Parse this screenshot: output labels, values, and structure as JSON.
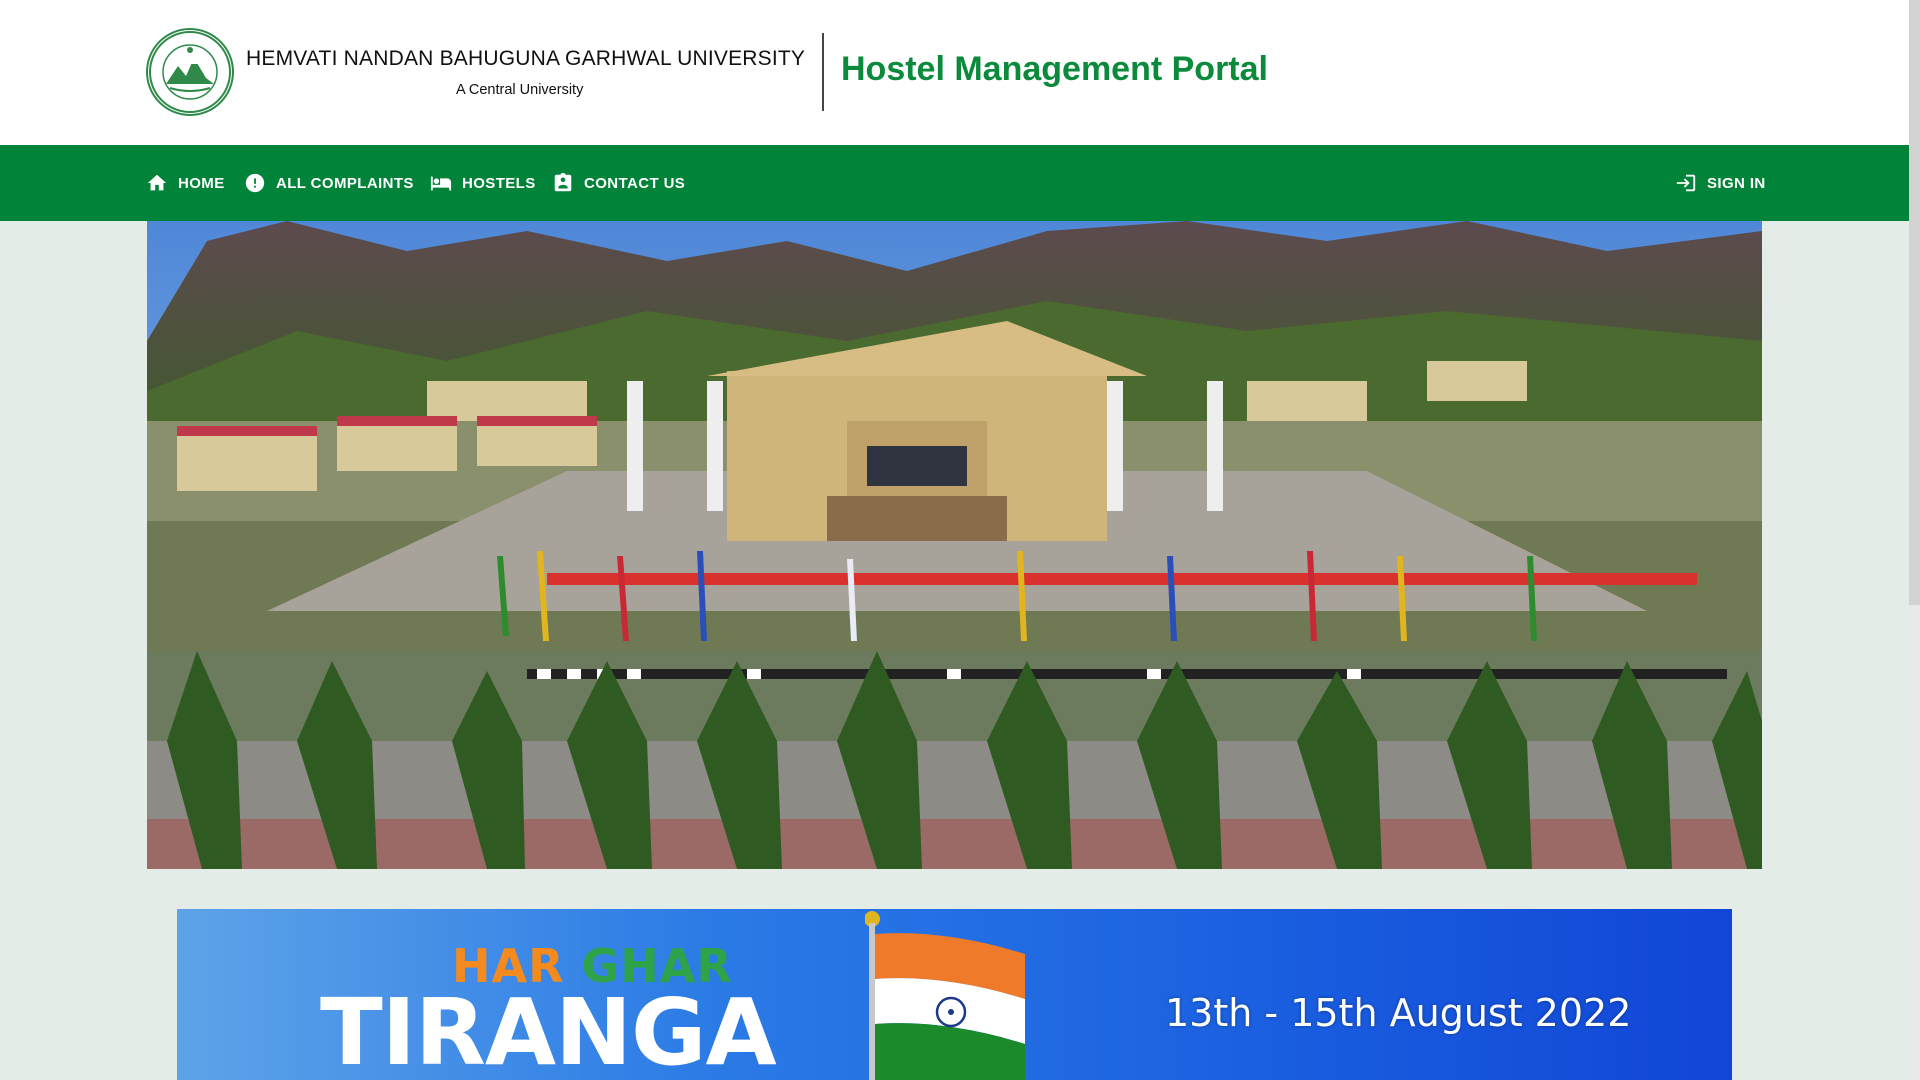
{
  "header": {
    "university_name": "HEMVATI NANDAN BAHUGUNA GARHWAL UNIVERSITY",
    "university_sub": "A Central University",
    "portal_title": "Hostel Management Portal"
  },
  "nav": {
    "items": [
      {
        "label": "HOME",
        "icon": "home-icon"
      },
      {
        "label": "ALL COMPLAINTS",
        "icon": "alert-circle-icon"
      },
      {
        "label": "HOSTELS",
        "icon": "bed-icon"
      },
      {
        "label": "CONTACT US",
        "icon": "contact-card-icon"
      }
    ],
    "signin": {
      "label": "SIGN IN",
      "icon": "login-icon"
    }
  },
  "banner": {
    "har": "HAR",
    "ghar": "GHAR",
    "tiranga": "TIRANGA",
    "dates": "13th - 15th August 2022"
  },
  "colors": {
    "brand_green": "#01843a",
    "title_green": "#0a8a3a",
    "page_bg": "#e3ece6",
    "banner_blue": "#1a5fe0"
  }
}
